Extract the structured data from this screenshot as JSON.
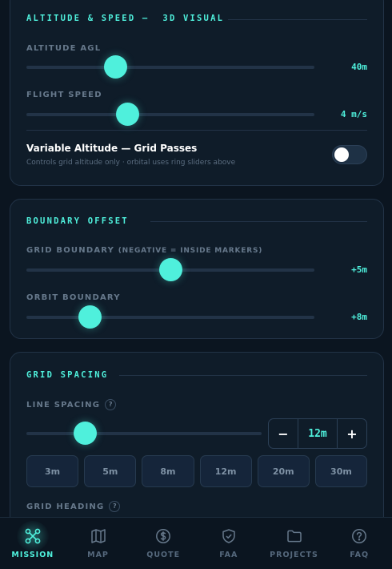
{
  "altitude_speed": {
    "title": "ALTITUDE & SPEED —  3D VISUAL",
    "altitude": {
      "label": "ALTITUDE AGL",
      "value": "40m",
      "level": 0.31
    },
    "speed": {
      "label": "FLIGHT SPEED",
      "value": "4 m/s",
      "level": 0.35
    },
    "variable_altitude": {
      "title": "Variable Altitude — Grid Passes",
      "description": "Controls grid altitude only · orbital uses ring sliders above",
      "enabled": false
    }
  },
  "boundary_offset": {
    "title": "BOUNDARY OFFSET",
    "grid": {
      "label": "GRID BOUNDARY",
      "sublabel": "(NEGATIVE = INSIDE MARKERS)",
      "value": "+5m",
      "level": 0.5
    },
    "orbit": {
      "label": "ORBIT BOUNDARY",
      "value": "+8m",
      "level": 0.22
    }
  },
  "grid_spacing": {
    "title": "GRID SPACING",
    "line_spacing": {
      "label": "LINE SPACING",
      "help": "?",
      "value": "12m",
      "level": 0.25
    },
    "stepper": {
      "minus": "−",
      "plus": "+"
    },
    "presets": [
      "3m",
      "5m",
      "8m",
      "12m",
      "20m",
      "30m"
    ],
    "heading": {
      "label": "GRID HEADING",
      "help": "?"
    }
  },
  "nav": [
    {
      "label": "MISSION",
      "icon": "drone-icon",
      "active": true
    },
    {
      "label": "MAP",
      "icon": "map-icon",
      "active": false
    },
    {
      "label": "QUOTE",
      "icon": "dollar-icon",
      "active": false
    },
    {
      "label": "FAA",
      "icon": "shield-check-icon",
      "active": false
    },
    {
      "label": "PROJECTS",
      "icon": "folder-icon",
      "active": false
    },
    {
      "label": "FAQ",
      "icon": "question-icon",
      "active": false
    }
  ],
  "colors": {
    "accent": "#4ff0dc",
    "background": "#0b1520",
    "card": "#0f1c29"
  }
}
